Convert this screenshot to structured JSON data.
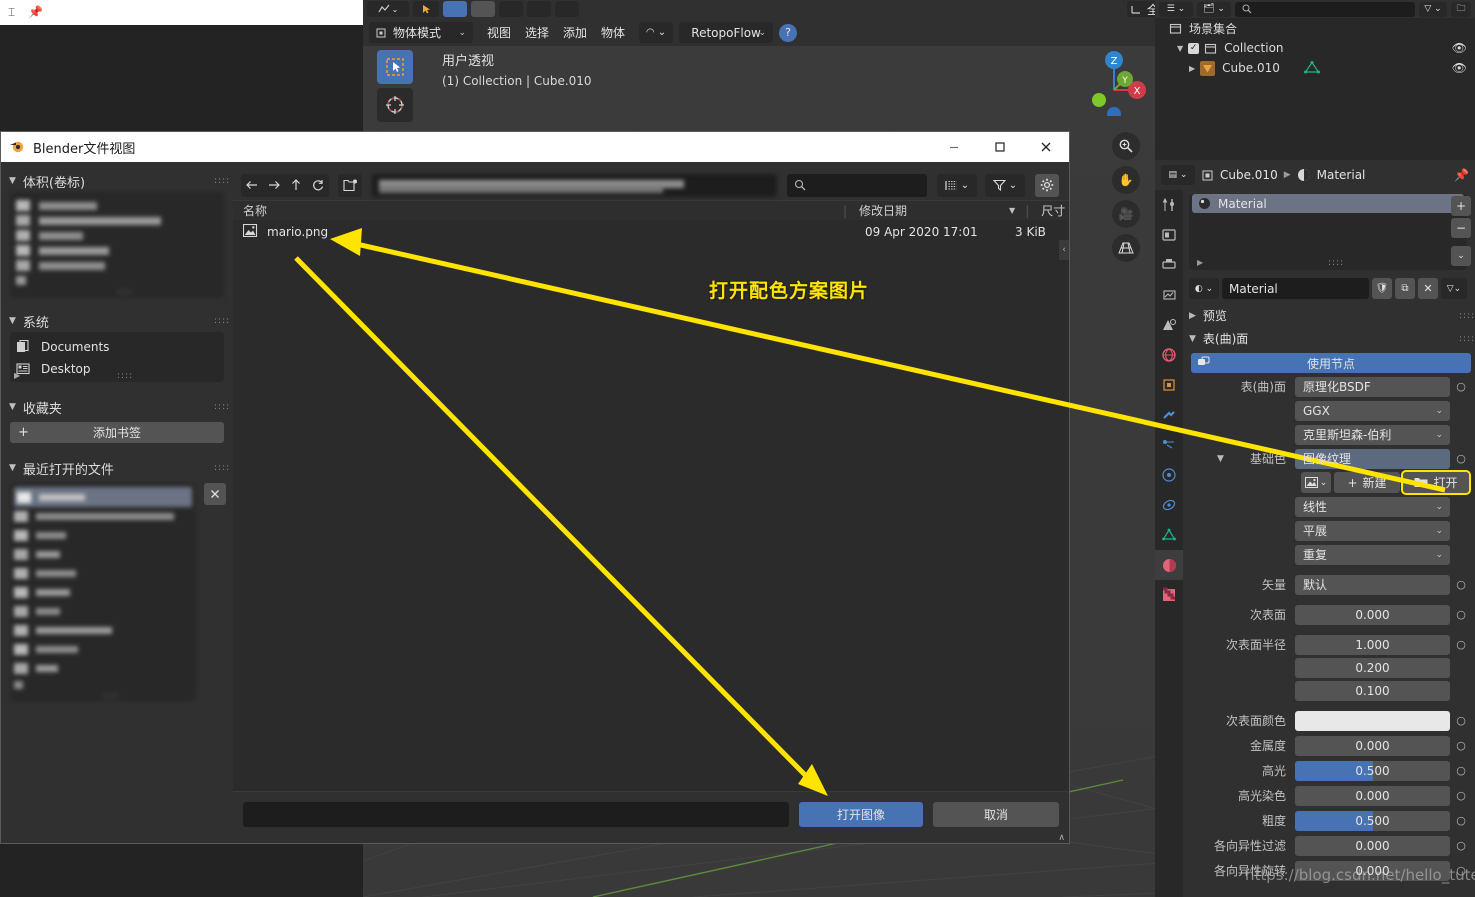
{
  "viewport": {
    "header": {
      "mode": "物体模式",
      "menus": [
        "视图",
        "选择",
        "添加",
        "物体"
      ],
      "addon": "RetopoFlow",
      "transform_orientation": "全局",
      "help_icon": "question-icon"
    },
    "overlay": {
      "view_name": "用户透视",
      "object_info": "(1) Collection | Cube.010"
    },
    "gizmo": {
      "x": "X",
      "y": "Y",
      "z": "Z"
    },
    "nav_icons": [
      "zoom-icon",
      "hand-icon",
      "camera-icon",
      "grid-icon"
    ],
    "tool_icons": [
      "select-box-icon",
      "cursor-icon"
    ]
  },
  "outliner": {
    "root": "场景集合",
    "items": [
      {
        "label": "Collection",
        "icon": "collection-icon",
        "checked": true,
        "indent": 1
      },
      {
        "label": "Cube.010",
        "icon": "mesh-object-icon",
        "indent": 2
      }
    ],
    "search_placeholder": ""
  },
  "properties": {
    "breadcrumb": [
      "Cube.010",
      "Material"
    ],
    "pin_icon": "pin-icon",
    "slot_list": [
      {
        "label": "Material",
        "selected": true
      }
    ],
    "slot_buttons": [
      "+",
      "−",
      "chevron-down-icon"
    ],
    "material_name": "Material",
    "material_buttons": [
      "shield-icon",
      "copy-icon",
      "close-icon"
    ],
    "sections": [
      {
        "label": "预览",
        "open": false
      },
      {
        "label": "表(曲)面",
        "open": true
      }
    ],
    "use_nodes_label": "使用节点",
    "rows": [
      {
        "label": "表(曲)面",
        "value": "原理化BSDF",
        "type": "enum-dot"
      },
      {
        "label": "",
        "value": "GGX",
        "type": "dropdown"
      },
      {
        "label": "",
        "value": "克里斯坦森-伯利",
        "type": "dropdown"
      },
      {
        "label": "基础色",
        "value": "图像纹理",
        "type": "enum-dot-active"
      },
      {
        "label": "",
        "value": "线性",
        "type": "dropdown"
      },
      {
        "label": "",
        "value": "平展",
        "type": "dropdown"
      },
      {
        "label": "",
        "value": "重复",
        "type": "dropdown"
      },
      {
        "label": "矢量",
        "value": "默认",
        "type": "enum-dot"
      },
      {
        "label": "次表面",
        "value": "0.000",
        "type": "value"
      },
      {
        "label": "次表面半径",
        "value": "1.000",
        "type": "value"
      },
      {
        "label": "",
        "value": "0.200",
        "type": "value"
      },
      {
        "label": "",
        "value": "0.100",
        "type": "value"
      },
      {
        "label": "次表面颜色",
        "value": "",
        "type": "color",
        "color": "#e8e8e8"
      },
      {
        "label": "金属度",
        "value": "0.000",
        "type": "value"
      },
      {
        "label": "高光",
        "value": "0.500",
        "type": "slider",
        "fill": 50
      },
      {
        "label": "高光染色",
        "value": "0.000",
        "type": "value"
      },
      {
        "label": "粗度",
        "value": "0.500",
        "type": "slider",
        "fill": 50
      },
      {
        "label": "各向异性过滤",
        "value": "0.000",
        "type": "value"
      },
      {
        "label": "各向异性旋转",
        "value": "0.000",
        "type": "value"
      }
    ],
    "image_texture": {
      "new_label": "新建",
      "open_label": "打开",
      "browse_icon": "image-browse-icon"
    },
    "tab_icons": [
      "tool-icon",
      "render-icon",
      "output-icon",
      "view-layer-icon",
      "scene-icon",
      "world-icon",
      "object-icon",
      "modifier-icon",
      "particles-icon",
      "physics-icon",
      "constraint-icon",
      "data-icon",
      "material-icon",
      "texture-icon"
    ]
  },
  "file_browser": {
    "title": "Blender文件视图",
    "title_icon": "blender-icon",
    "window_buttons": [
      "minimize",
      "maximize",
      "close"
    ],
    "nav_buttons": [
      "back-icon",
      "forward-icon",
      "up-icon",
      "refresh-icon",
      "new-folder-icon"
    ],
    "path_value": "",
    "search_placeholder": "",
    "display_mode_icon": "list-view-icon",
    "filter_icon": "funnel-icon",
    "settings_icon": "gear-icon",
    "columns": [
      "名称",
      "修改日期",
      "尺寸"
    ],
    "files": [
      {
        "name": "mario.png",
        "icon": "image-file-icon",
        "date": "09 Apr 2020 17:01",
        "size": "3 KiB"
      }
    ],
    "filename_value": "",
    "confirm_label": "打开图像",
    "cancel_label": "取消",
    "sidebar": {
      "sections": [
        {
          "title": "体积(卷标)",
          "open": true,
          "items": [],
          "blurred": true,
          "blurred_rows": 7
        },
        {
          "title": "系统",
          "open": true,
          "items": [
            {
              "label": "Documents",
              "icon": "documents-icon"
            },
            {
              "label": "Desktop",
              "icon": "desktop-icon"
            }
          ]
        },
        {
          "title": "收藏夹",
          "open": true,
          "add_bookmark": "添加书签"
        },
        {
          "title": "最近打开的文件",
          "open": true,
          "blurred": true,
          "blurred_rows": 11,
          "clear_icon": "close-icon"
        }
      ]
    }
  },
  "annotation": {
    "text": "打开配色方案图片",
    "color": "#ffe400"
  },
  "watermark": "https://blog.csdn.net/hello_tute",
  "colors": {
    "accent_blue": "#4772b3",
    "annotation_yellow": "#ffe400",
    "panel_bg": "#303030",
    "dark_bg": "#282828",
    "viewport_bg": "#3a3a3a"
  }
}
